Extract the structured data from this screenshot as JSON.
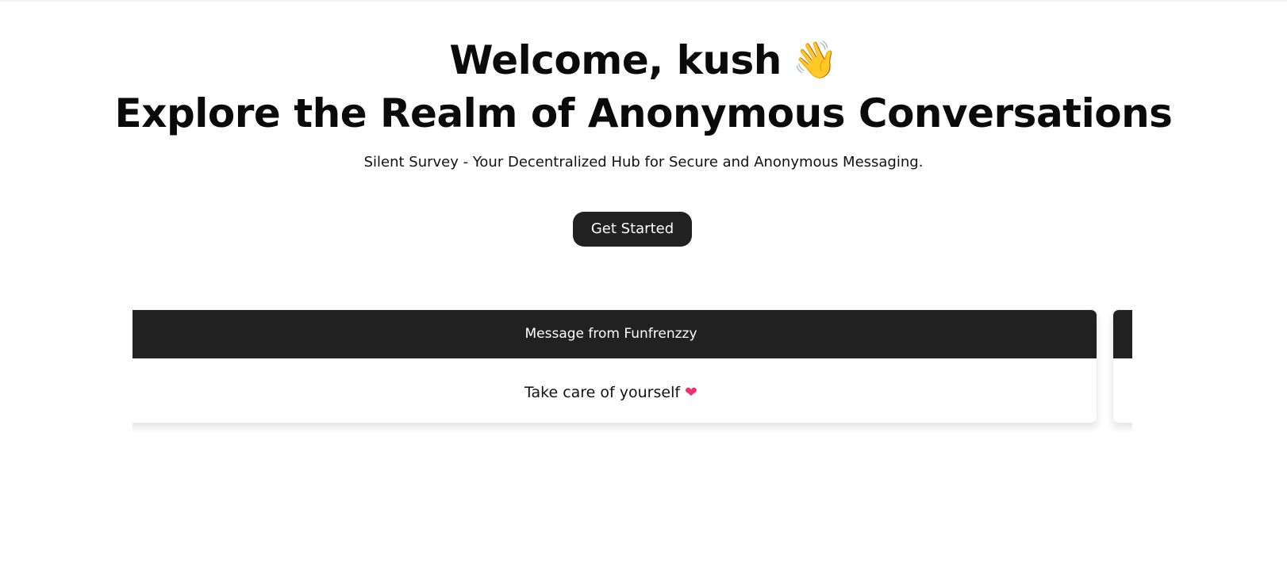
{
  "hero": {
    "welcome": "Welcome, kush",
    "welcome_emoji": "👋",
    "tagline": "Explore the Realm of Anonymous Conversations",
    "subtitle": "Silent Survey - Your Decentralized Hub for Secure and Anonymous Messaging.",
    "cta_label": "Get Started"
  },
  "messages": [
    {
      "header": "Message from Funfrenzzy",
      "body": "Take care of yourself",
      "emoji": "❤",
      "icon": "heart-icon"
    }
  ],
  "colors": {
    "dark": "#212121",
    "background": "#ffffff",
    "heart": "#f0306a"
  }
}
